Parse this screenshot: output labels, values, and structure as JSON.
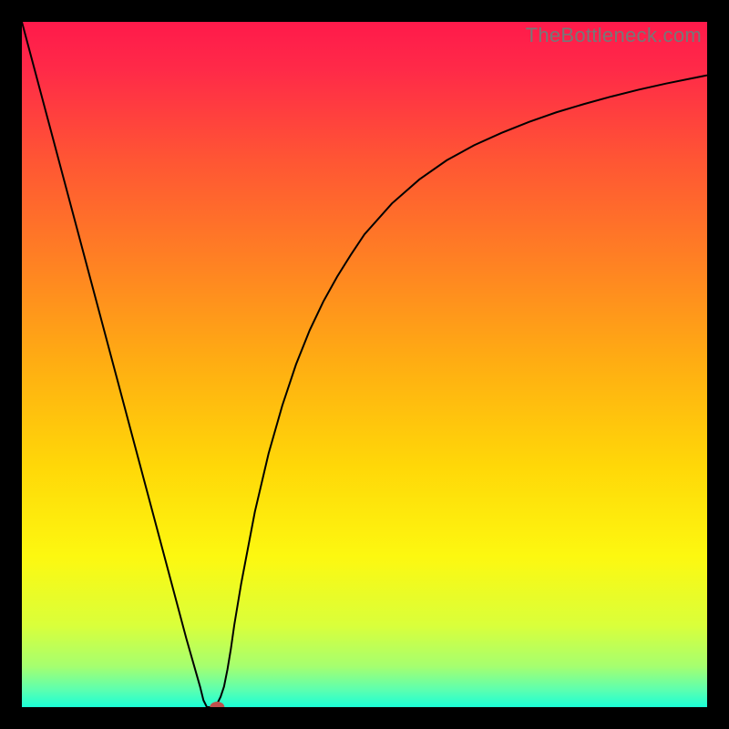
{
  "watermark": "TheBottleneck.com",
  "chart_data": {
    "type": "line",
    "title": "",
    "xlabel": "",
    "ylabel": "",
    "xlim": [
      0,
      1
    ],
    "ylim": [
      0,
      1
    ],
    "background_gradient": {
      "stops": [
        {
          "offset": 0.0,
          "color": "#ff1a4b"
        },
        {
          "offset": 0.07,
          "color": "#ff2a48"
        },
        {
          "offset": 0.2,
          "color": "#ff5534"
        },
        {
          "offset": 0.35,
          "color": "#ff8123"
        },
        {
          "offset": 0.5,
          "color": "#ffae12"
        },
        {
          "offset": 0.65,
          "color": "#ffd808"
        },
        {
          "offset": 0.78,
          "color": "#fdf810"
        },
        {
          "offset": 0.88,
          "color": "#daff3a"
        },
        {
          "offset": 0.94,
          "color": "#a6ff6f"
        },
        {
          "offset": 0.975,
          "color": "#5cffb0"
        },
        {
          "offset": 1.0,
          "color": "#1affd6"
        }
      ]
    },
    "series": [
      {
        "name": "curve",
        "color": "#000000",
        "width": 2,
        "x": [
          0.0,
          0.02,
          0.04,
          0.06,
          0.08,
          0.1,
          0.12,
          0.14,
          0.16,
          0.18,
          0.2,
          0.22,
          0.24,
          0.26,
          0.265,
          0.27,
          0.28,
          0.285,
          0.29,
          0.295,
          0.3,
          0.305,
          0.31,
          0.32,
          0.34,
          0.36,
          0.38,
          0.4,
          0.42,
          0.44,
          0.46,
          0.48,
          0.5,
          0.54,
          0.58,
          0.62,
          0.66,
          0.7,
          0.74,
          0.78,
          0.82,
          0.86,
          0.9,
          0.94,
          0.98,
          1.0
        ],
        "y": [
          1.0,
          0.925,
          0.85,
          0.775,
          0.7,
          0.625,
          0.55,
          0.475,
          0.4,
          0.325,
          0.25,
          0.175,
          0.1,
          0.03,
          0.01,
          0.0,
          0.0,
          0.005,
          0.015,
          0.03,
          0.055,
          0.085,
          0.12,
          0.18,
          0.285,
          0.37,
          0.44,
          0.5,
          0.55,
          0.592,
          0.628,
          0.66,
          0.69,
          0.735,
          0.77,
          0.798,
          0.82,
          0.838,
          0.854,
          0.868,
          0.88,
          0.891,
          0.901,
          0.91,
          0.918,
          0.922
        ]
      }
    ],
    "marker": {
      "x": 0.285,
      "y": 0.0,
      "color": "#c0504d",
      "rx": 8,
      "ry": 6
    }
  }
}
